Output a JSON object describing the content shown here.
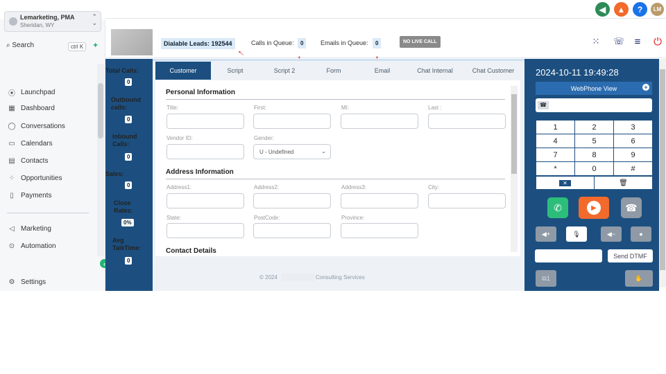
{
  "account": {
    "name": "Lemarketing, PMA",
    "location": "Sheridan, WY"
  },
  "search": {
    "label": "Search",
    "shortcut": "ctrl K"
  },
  "nav": [
    {
      "label": "Launchpad",
      "icon": "rocket-icon"
    },
    {
      "label": "Dashboard",
      "icon": "grid-icon"
    },
    {
      "label": "Conversations",
      "icon": "chat-icon"
    },
    {
      "label": "Calendars",
      "icon": "calendar-icon"
    },
    {
      "label": "Contacts",
      "icon": "contacts-icon"
    },
    {
      "label": "Opportunities",
      "icon": "opportunities-icon"
    },
    {
      "label": "Payments",
      "icon": "payments-icon"
    },
    {
      "label": "Marketing",
      "icon": "send-icon"
    },
    {
      "label": "Automation",
      "icon": "automation-icon"
    },
    {
      "label": "Settings",
      "icon": "gear-icon"
    }
  ],
  "header": {
    "avatar_initials": "LM"
  },
  "agent": {
    "dialable_leads": "Dialable Leads: 192544",
    "calls_queue_label": "Calls in Queue:",
    "calls_queue_value": "0",
    "emails_queue_label": "Emails in Queue:",
    "emails_queue_value": "0",
    "no_live_call": "NO LIVE CALL"
  },
  "stats": [
    {
      "label": "Total Calls:",
      "value": "0"
    },
    {
      "label": "Outbound calls:",
      "value": "0"
    },
    {
      "label": "Inbound Calls:",
      "value": "0"
    },
    {
      "label": "Sales:",
      "value": "0"
    },
    {
      "label": "Close Rates:",
      "value": "0%"
    },
    {
      "label": "Avg TalkTime:",
      "value": "0"
    }
  ],
  "tabs": [
    "Customer",
    "Script",
    "Script 2",
    "Form",
    "Email",
    "Chat Internal",
    "Chat Customer"
  ],
  "form": {
    "personal": "Personal Information",
    "title": "Title:",
    "first": "First:",
    "mi": "MI:",
    "last": "Last :",
    "vendor": "Vendor ID:",
    "gender": "Gender:",
    "gender_value": "U - Undefined",
    "address": "Address Information",
    "address1": "Address1:",
    "address2": "Address2:",
    "address3": "Address3:",
    "city": "City:",
    "state": "State:",
    "postcode": "PostCode:",
    "province": "Province:",
    "contact": "Contact Details"
  },
  "footer": {
    "year": "© 2024",
    "company": "Consulting Services"
  },
  "phone": {
    "datetime": "2024-10-11 19:49:28",
    "webphone_view": "WebPhone View",
    "keys": [
      "1",
      "2",
      "3",
      "4",
      "5",
      "6",
      "7",
      "8",
      "9",
      "*",
      "0",
      "#"
    ],
    "send_dtmf": "Send DTMF",
    "bottom_left_label": "1"
  },
  "colors": {
    "navy": "#1c4f80",
    "green": "#2dbd7a",
    "orange": "#f26a2c",
    "accent": "#22b573"
  }
}
